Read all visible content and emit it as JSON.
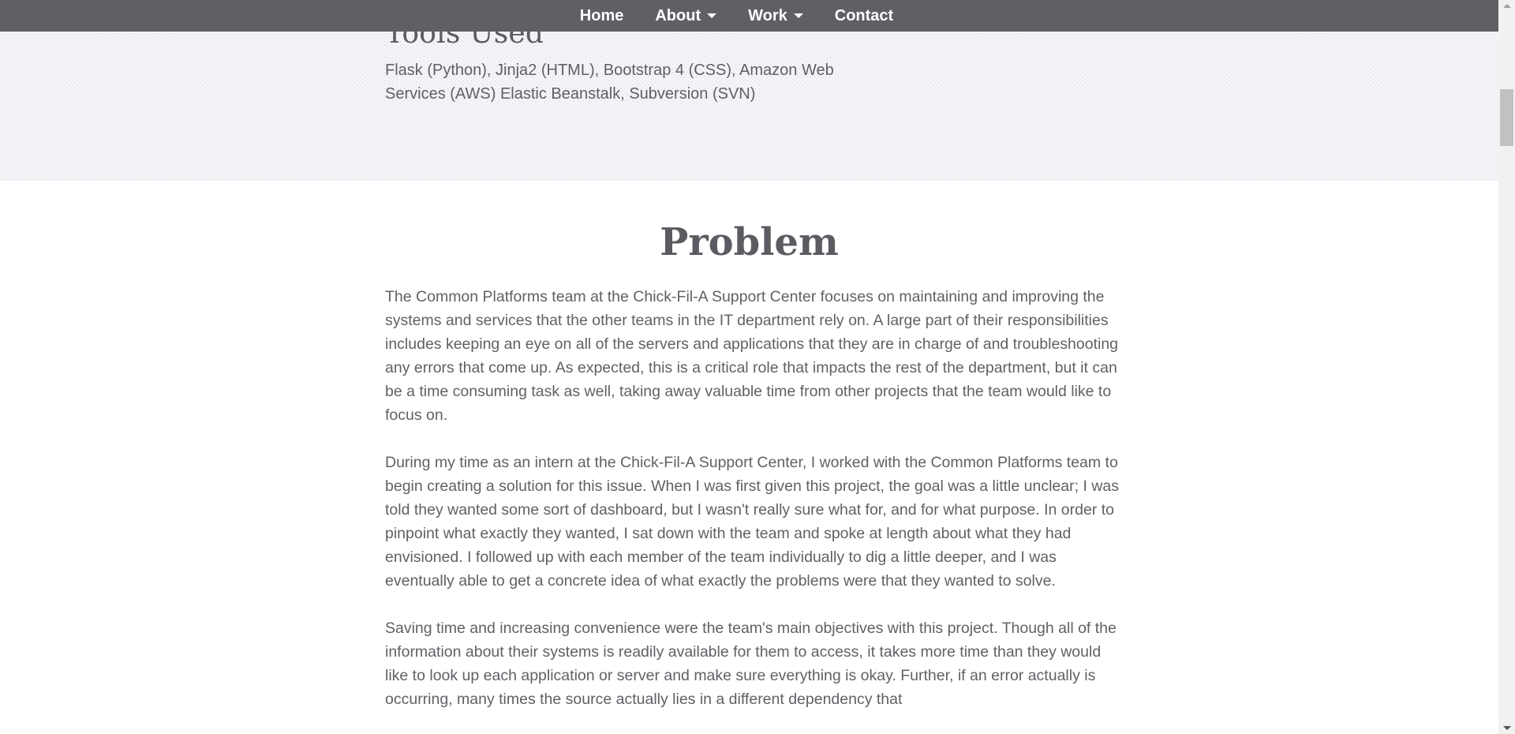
{
  "nav": {
    "items": [
      {
        "label": "Home",
        "dropdown": false
      },
      {
        "label": "About",
        "dropdown": true
      },
      {
        "label": "Work",
        "dropdown": true
      },
      {
        "label": "Contact",
        "dropdown": false
      }
    ]
  },
  "tools": {
    "heading": "Tools Used",
    "text": "Flask (Python), Jinja2 (HTML), Bootstrap 4 (CSS), Amazon Web Services (AWS) Elastic Beanstalk, Subversion (SVN)"
  },
  "problem": {
    "title": "Problem",
    "paragraphs": [
      "The Common Platforms team at the Chick-Fil-A Support Center focuses on maintaining and improving the systems and services that the other teams in the IT department rely on. A large part of their responsibilities includes keeping an eye on all of the servers and applications that they are in charge of and troubleshooting any errors that come up. As expected, this is a critical role that impacts the rest of the department, but it can be a time consuming task as well, taking away valuable time from other projects that the team would like to focus on.",
      "During my time as an intern at the Chick-Fil-A Support Center, I worked with the Common Platforms team to begin creating a solution for this issue. When I was first given this project, the goal was a little unclear; I was told they wanted some sort of dashboard, but I wasn't really sure what for, and for what purpose. In order to pinpoint what exactly they wanted, I sat down with the team and spoke at length about what they had envisioned. I followed up with each member of the team individually to dig a little deeper, and I was eventually able to get a concrete idea of what exactly the problems were that they wanted to solve.",
      "Saving time and increasing convenience were the team's main objectives with this project. Though all of the information about their systems is readily available for them to access, it takes more time than they would like to look up each application or server and make sure everything is okay. Further, if an error actually is occurring, many times the source actually lies in a different dependency that"
    ]
  },
  "colors": {
    "navbar": "#5f6064",
    "text": "#606166",
    "pattern_bg": "#f6f6f9"
  }
}
